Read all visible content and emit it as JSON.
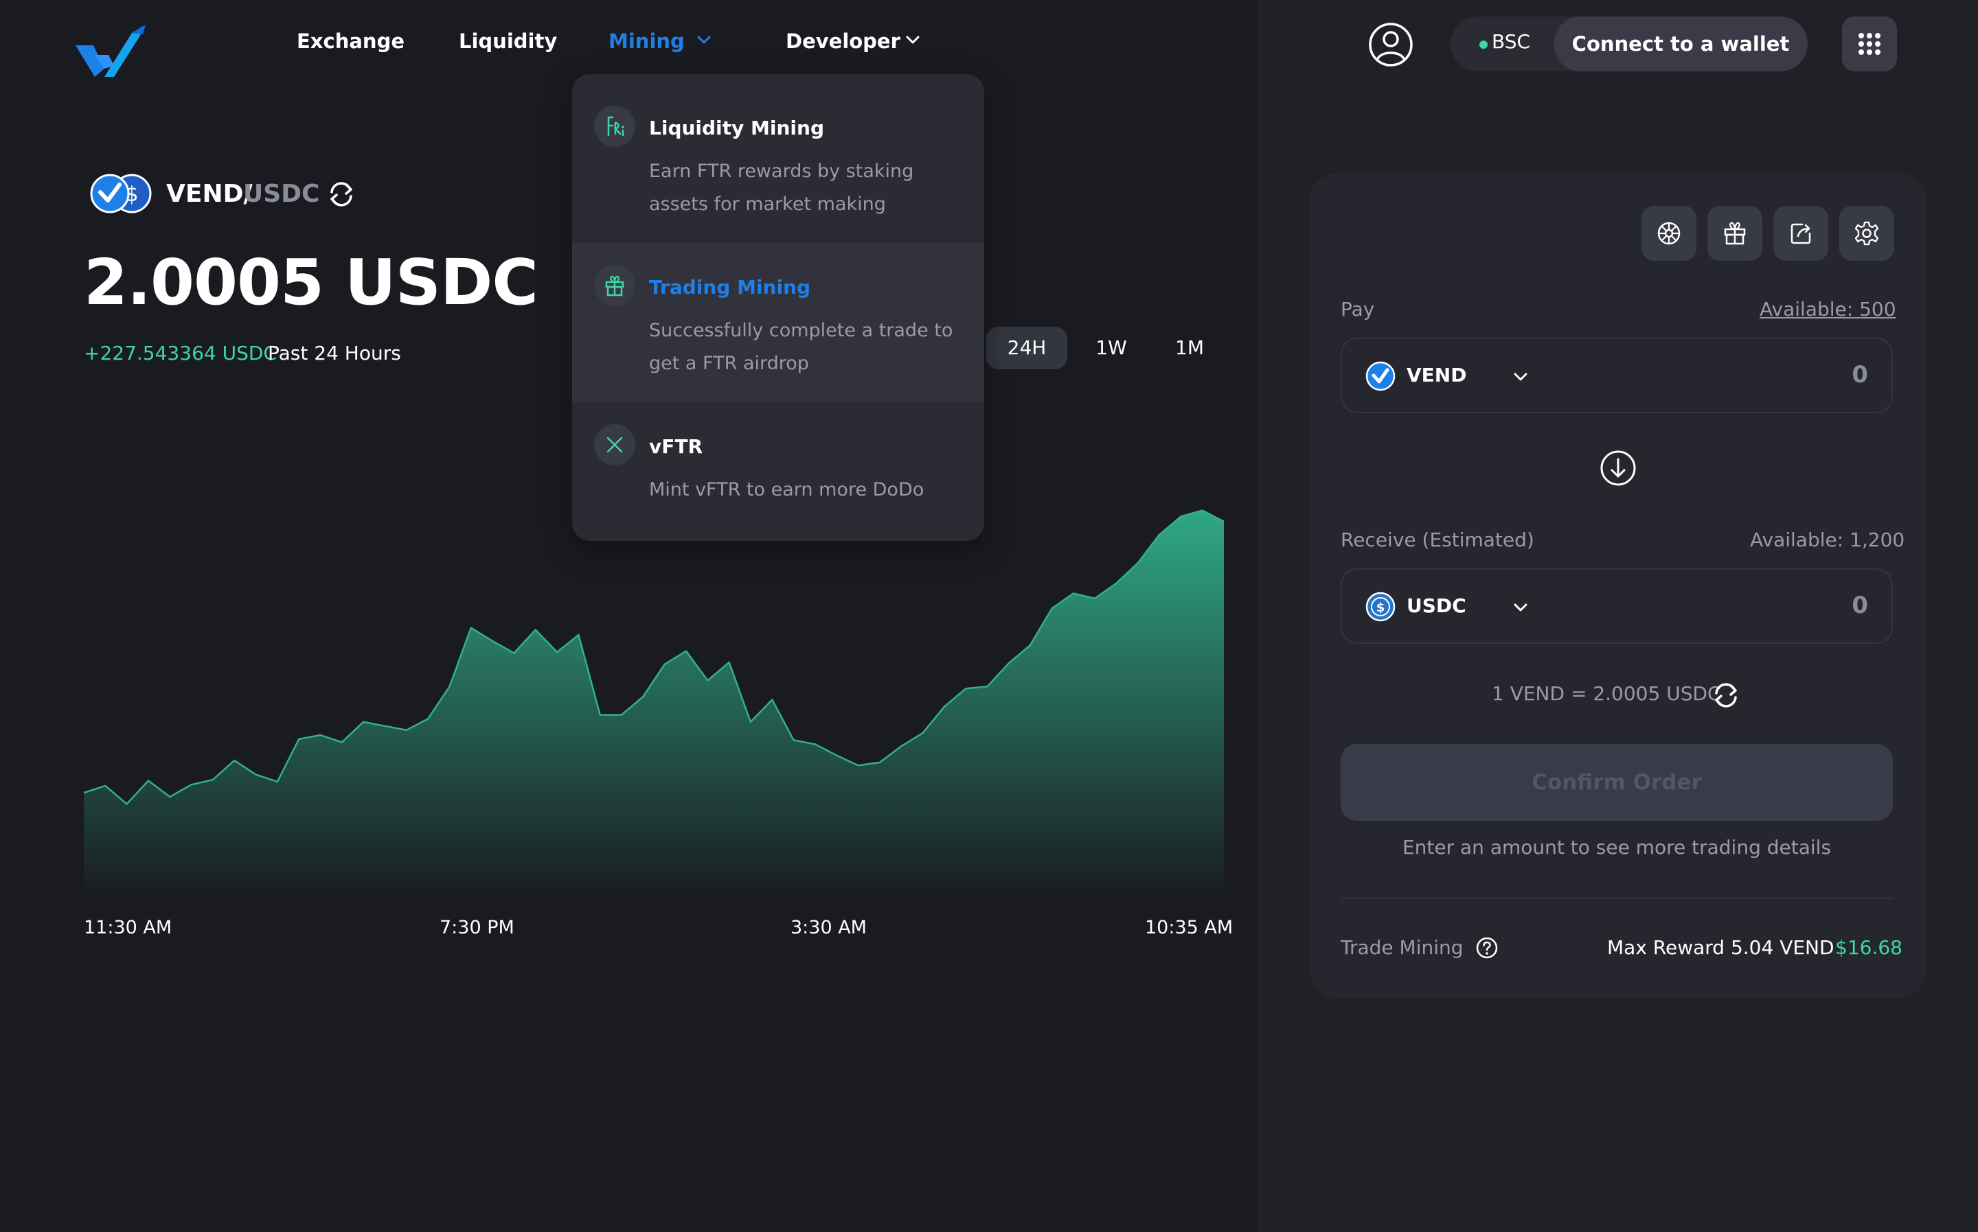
{
  "nav": {
    "items": [
      {
        "label": "Exchange"
      },
      {
        "label": "Liquidity"
      },
      {
        "label": "Mining",
        "active": true
      },
      {
        "label": "Developer"
      }
    ]
  },
  "dropdown": {
    "items": [
      {
        "title": "Liquidity Mining",
        "desc": "Earn FTR rewards by staking assets for market making",
        "icon": "liquidity-mining-icon"
      },
      {
        "title": "Trading Mining",
        "desc": "Successfully complete a trade to get a FTR airdrop",
        "icon": "gift-icon",
        "highlighted": true
      },
      {
        "title": "vFTR",
        "desc": "Mint vFTR to earn more DoDo",
        "icon": "vftr-icon"
      }
    ]
  },
  "pair": {
    "base": "VEND/",
    "quote": "USDC"
  },
  "price": "2.0005 USDC",
  "change": "+227.543364 USDC",
  "period": "Past 24 Hours",
  "timeframes": [
    "24H",
    "1W",
    "1M"
  ],
  "chart_data": {
    "type": "area",
    "x_labels": [
      "11:30 AM",
      "7:30 PM",
      "3:30 AM",
      "10:35 AM"
    ],
    "values": [
      105,
      112,
      94,
      117,
      101,
      113,
      118,
      137,
      123,
      116,
      158,
      162,
      155,
      175,
      171,
      167,
      178,
      210,
      268,
      255,
      243,
      266,
      244,
      261,
      182,
      182,
      200,
      232,
      245,
      216,
      234,
      175,
      197,
      157,
      153,
      142,
      132,
      135,
      151,
      164,
      190,
      208,
      210,
      233,
      251,
      287,
      302,
      297,
      312,
      332,
      360,
      378,
      384,
      373
    ],
    "color": "#2fb386",
    "fill_top": "#2fa882",
    "fill_bottom": "#1a1b20"
  },
  "header": {
    "network": "BSC",
    "connect": "Connect to a wallet"
  },
  "trade": {
    "pay_label": "Pay",
    "pay_available": "Available: 500",
    "pay_token": "VEND",
    "pay_amount": "0",
    "receive_label": "Receive (Estimated)",
    "receive_available": "Available: 1,200",
    "receive_token": "USDC",
    "receive_amount": "0",
    "rate": "1 VEND = 2.0005 USDC",
    "confirm": "Confirm Order",
    "hint": "Enter an amount to see more trading details",
    "mining_label": "Trade Mining",
    "max_reward": "Max Reward 5.04 VEND",
    "reward_usd": "$16.68"
  },
  "colors": {
    "accent_blue": "#1d7fe8",
    "accent_green": "#3ed7a5",
    "background": "#1a1b20"
  }
}
